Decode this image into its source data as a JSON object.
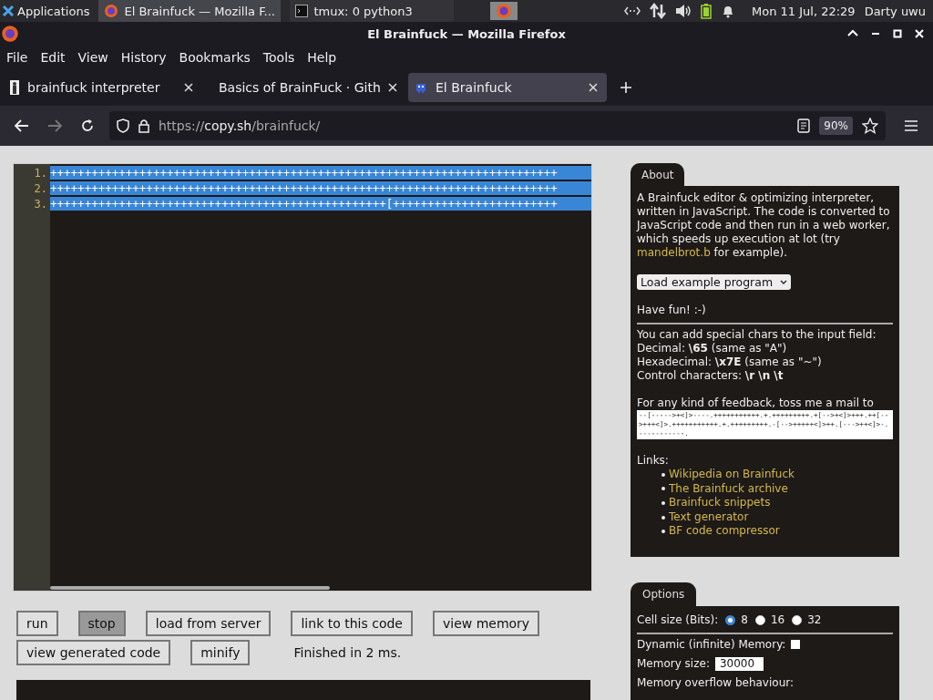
{
  "taskbar": {
    "apps_label": "Applications",
    "tasks": [
      {
        "label": "El Brainfuck — Mozilla F...",
        "kind": "browser",
        "selected": true
      },
      {
        "label": "tmux: 0 python3",
        "kind": "terminal",
        "selected": false
      }
    ],
    "clock": "Mon 11 Jul, 22:29",
    "user": "Darty uwu"
  },
  "window": {
    "title": "El Brainfuck — Mozilla Firefox"
  },
  "menu": [
    "File",
    "Edit",
    "View",
    "History",
    "Bookmarks",
    "Tools",
    "Help"
  ],
  "tabs": [
    {
      "label": "brainfuck interpreter",
      "kind": "page",
      "selected": false
    },
    {
      "label": "Basics of BrainFuck · Gith",
      "kind": "github",
      "selected": false
    },
    {
      "label": "El Brainfuck",
      "kind": "bf",
      "selected": true
    }
  ],
  "address": {
    "scheme": "https://",
    "host": "copy.sh",
    "path": "/brainfuck/",
    "zoom": "90%"
  },
  "editor": {
    "lines": [
      {
        "number": "1.",
        "code": "++++++++++++++++++++++++++++++++++++++++++++++++++++++++++++++++++++++++++"
      },
      {
        "number": "2.",
        "code": "++++++++++++++++++++++++++++++++++++++++++++++++++++++++++++++++++++++++++"
      },
      {
        "number": "3.",
        "code": "+++++++++++++++++++++++++++++++++++++++++++++++++[++++++++++++++++++++++++"
      }
    ]
  },
  "buttons": [
    [
      {
        "label": "run",
        "pressed": false
      },
      {
        "label": "stop",
        "pressed": true
      },
      {
        "label": "load from server",
        "pressed": false
      },
      {
        "label": "link to this code",
        "pressed": false
      },
      {
        "label": "view memory",
        "pressed": false
      }
    ],
    [
      {
        "label": "view generated code",
        "pressed": false
      },
      {
        "label": "minify",
        "pressed": false
      }
    ]
  ],
  "status": "Finished in 2 ms.",
  "about": {
    "tab": "About",
    "intro": "A Brainfuck editor & optimizing interpreter, written in JavaScript. The code is converted to JavaScript code and then run in a web worker, which speeds up execution at lot (try ",
    "intro_link": "mandelbrot.b",
    "intro_end": " for example).",
    "select": "Load example program",
    "fun": "Have fun! :-)",
    "special": [
      "You can add special chars to the input field:",
      "Decimal: **\\65** (same as \"A\")",
      "Hexadecimal: **\\x7E** (same as \"~\")",
      "Control characters: **\\r \\n \\t**"
    ],
    "feedback": "For any kind of feedback, toss me a mail to",
    "mail_code": "--[----->+<]>----.+++++++++++.+.+++++++++.+[-->+<]>+++.++[-->+++<]>.+++++++++++.+.+++++++++.-[-->+++++<]>++.[--->++<]>-.-----------.",
    "links_label": "Links:",
    "links": [
      "Wikipedia on Brainfuck",
      "The Brainfuck archive",
      "Brainfuck snippets",
      "Text generator",
      "BF code compressor"
    ]
  },
  "options": {
    "tab": "Options",
    "cell_size_label": "Cell size (Bits):",
    "cell_sizes": [
      {
        "label": "8",
        "selected": true
      },
      {
        "label": "16",
        "selected": false
      },
      {
        "label": "32",
        "selected": false
      }
    ],
    "dynamic_label": "Dynamic (infinite) Memory:",
    "dynamic_checked": false,
    "memory_size_label": "Memory size:",
    "memory_size": "30000",
    "overflow_label": "Memory overflow behaviour:"
  }
}
